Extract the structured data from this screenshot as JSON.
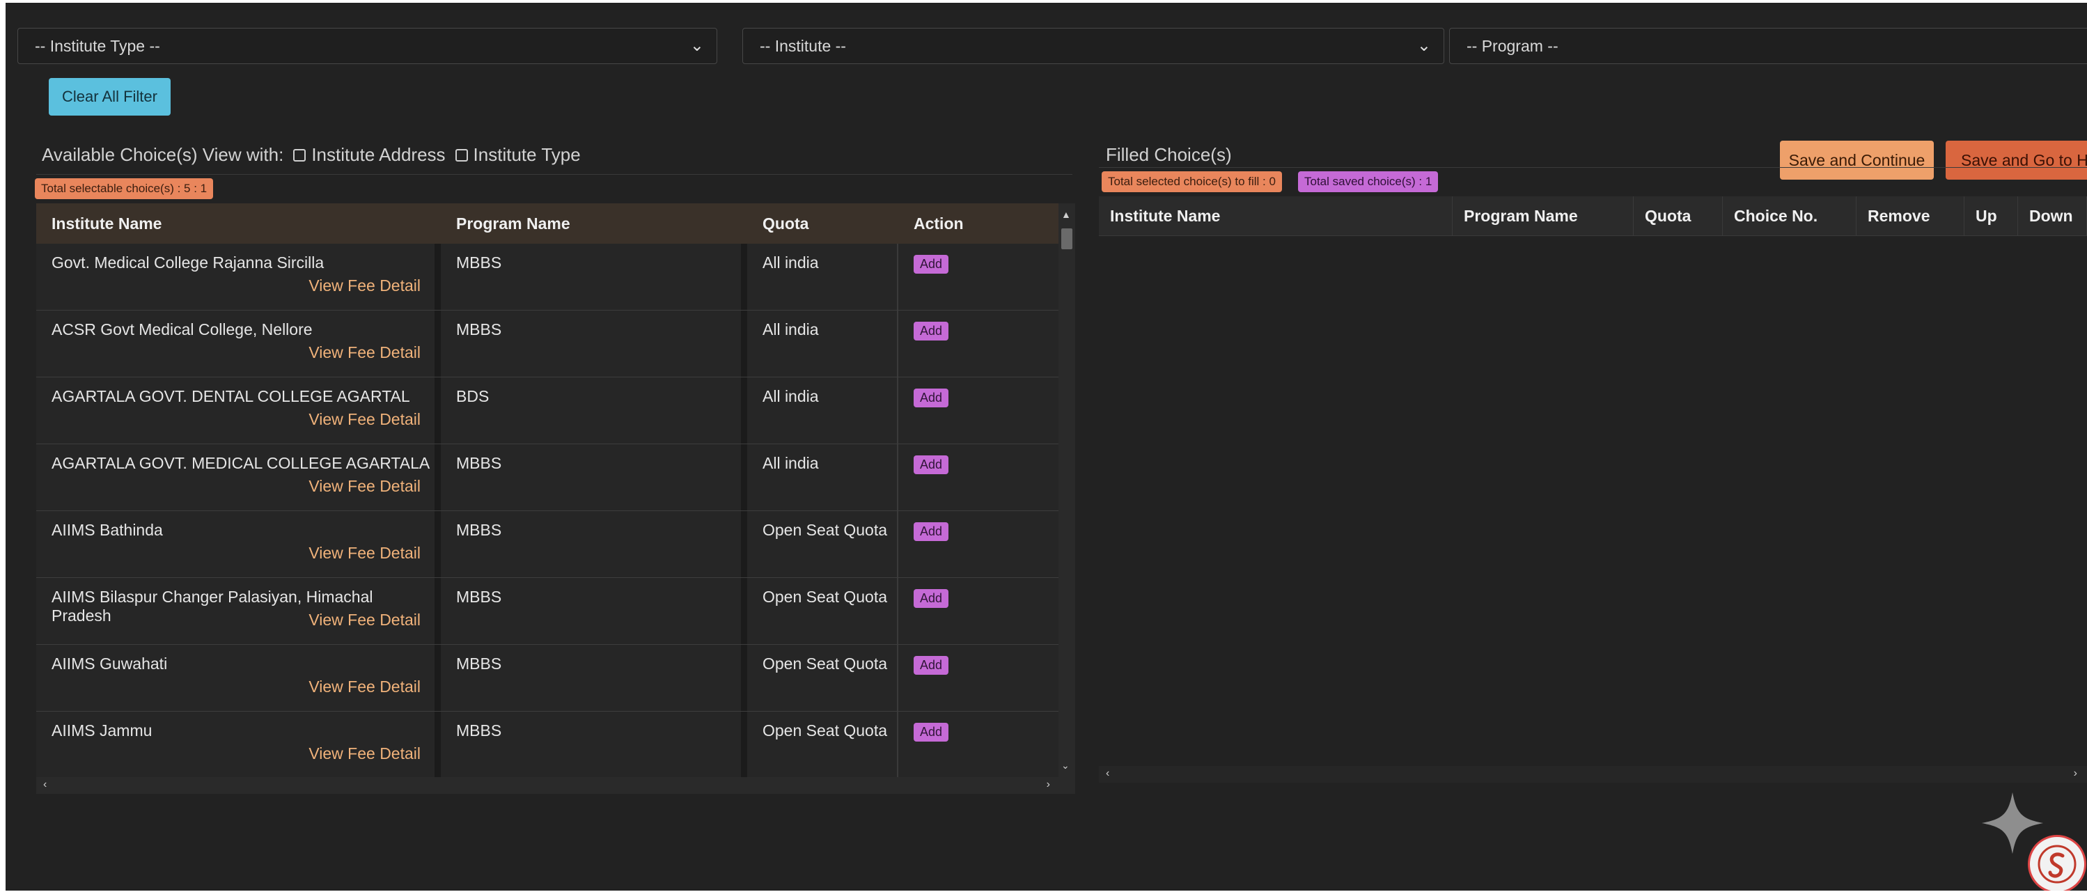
{
  "filters": {
    "institute_type": "-- Institute Type --",
    "institute": "-- Institute --",
    "program": "-- Program --",
    "clear_label": "Clear All Filter"
  },
  "available": {
    "view_with_label": "Available Choice(s) View with:",
    "opt_address": "Institute Address",
    "opt_type": "Institute Type",
    "total_badge": "Total selectable choice(s) : 5 : 1",
    "headers": [
      "Institute Name",
      "Program Name",
      "Quota",
      "Action"
    ],
    "rows": [
      {
        "institute": "Govt. Medical College Rajanna Sircilla",
        "fee": "View Fee Detail",
        "program": "MBBS",
        "quota": "All india",
        "action": "Add"
      },
      {
        "institute": "ACSR Govt Medical College, Nellore",
        "fee": "View Fee Detail",
        "program": "MBBS",
        "quota": "All india",
        "action": "Add"
      },
      {
        "institute": "AGARTALA GOVT. DENTAL COLLEGE AGARTAL",
        "fee": "View Fee Detail",
        "program": "BDS",
        "quota": "All india",
        "action": "Add"
      },
      {
        "institute": "AGARTALA GOVT. MEDICAL COLLEGE AGARTALA",
        "fee": "View Fee Detail",
        "program": "MBBS",
        "quota": "All india",
        "action": "Add"
      },
      {
        "institute": "AIIMS Bathinda",
        "fee": "View Fee Detail",
        "program": "MBBS",
        "quota": "Open Seat Quota",
        "action": "Add"
      },
      {
        "institute": "AIIMS Bilaspur Changer Palasiyan, Himachal Pradesh",
        "fee": "View Fee Detail",
        "program": "MBBS",
        "quota": "Open Seat Quota",
        "action": "Add"
      },
      {
        "institute": "AIIMS Guwahati",
        "fee": "View Fee Detail",
        "program": "MBBS",
        "quota": "Open Seat Quota",
        "action": "Add"
      },
      {
        "institute": "AIIMS Jammu",
        "fee": "View Fee Detail",
        "program": "MBBS",
        "quota": "Open Seat Quota",
        "action": "Add"
      }
    ]
  },
  "filled": {
    "title": "Filled Choice(s)",
    "to_fill_badge": "Total selected choice(s) to fill : 0",
    "saved_badge": "Total saved choice(s) : 1",
    "save_continue": "Save and Continue",
    "save_home": "Save and Go to Ho",
    "headers": [
      "Institute Name",
      "Program Name",
      "Quota",
      "Choice No.",
      "Remove",
      "Up",
      "Down"
    ]
  },
  "icons": {
    "dropdown": "chevron-down-icon",
    "sparkle": "sparkle-icon",
    "logo": "brand-logo"
  },
  "colors": {
    "background": "#222222",
    "clear_button": "#5bc0de",
    "add_button": "#c56ad6",
    "fee_link": "#f0b27a",
    "save_continue": "#eea06a",
    "save_home": "#d9663f"
  }
}
